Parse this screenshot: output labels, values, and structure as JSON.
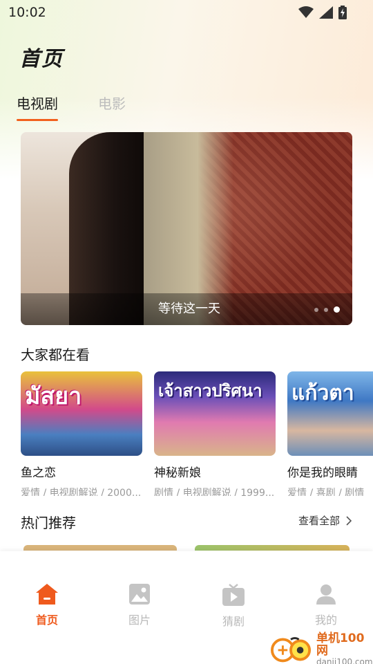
{
  "status_bar": {
    "time": "10:02",
    "icons": [
      "wifi-icon",
      "signal-icon",
      "battery-charging-icon"
    ]
  },
  "header": {
    "title": "首页"
  },
  "tabs": [
    {
      "label": "电视剧",
      "active": true
    },
    {
      "label": "电影",
      "active": false
    }
  ],
  "banner": {
    "caption": "等待这一天",
    "dots": 3,
    "active_dot": 3
  },
  "popular": {
    "title": "大家都在看",
    "items": [
      {
        "name": "鱼之恋",
        "tags": "爱情 / 电视剧解说 / 2000...",
        "poster_text": "มัสยา"
      },
      {
        "name": "神秘新娘",
        "tags": "剧情 / 电视剧解说 / 1999...",
        "poster_text": "เจ้าสาวปริศนา"
      },
      {
        "name": "你是我的眼睛",
        "tags": "爱情 / 喜剧 / 剧情",
        "poster_text": "แก้วตา"
      }
    ]
  },
  "recommend": {
    "title": "热门推荐",
    "see_all_label": "查看全部"
  },
  "bottom_nav": [
    {
      "label": "首页",
      "icon": "home-icon",
      "active": true
    },
    {
      "label": "图片",
      "icon": "image-icon",
      "active": false
    },
    {
      "label": "猜剧",
      "icon": "tv-play-icon",
      "active": false
    },
    {
      "label": "我的",
      "icon": "user-icon",
      "active": false
    }
  ],
  "watermark": {
    "line1": "单机100网",
    "line2": "danji100.com"
  },
  "colors": {
    "accent": "#ef5a1d",
    "inactive": "#b9b9b9"
  }
}
